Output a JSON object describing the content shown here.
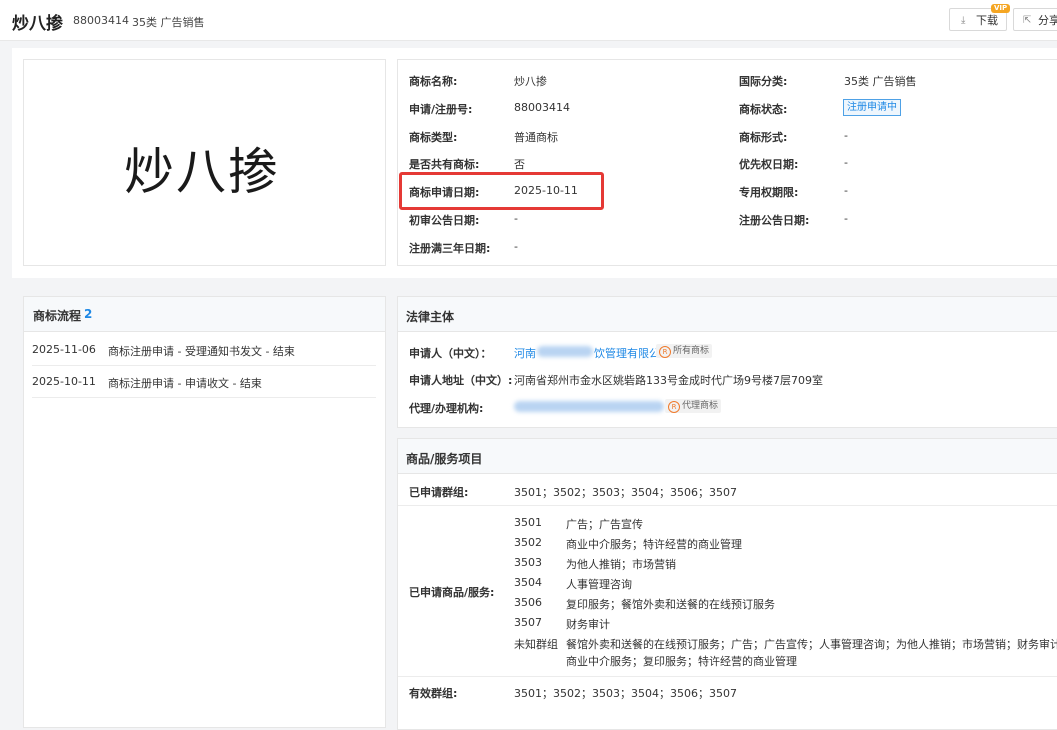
{
  "header": {
    "name": "炒八掺",
    "reg_no": "88003414",
    "class": "35类 广告销售",
    "download_label": "下载",
    "vip_badge": "VIP",
    "share_label": "分享",
    "download_icon": "⤓",
    "share_icon": "⇱"
  },
  "trademark_image_text": "炒八掺",
  "info": {
    "name_label": "商标名称:",
    "name_value": "炒八掺",
    "appno_label": "申请/注册号:",
    "appno_value": "88003414",
    "type_label": "商标类型:",
    "type_value": "普通商标",
    "shared_label": "是否共有商标:",
    "shared_value": "否",
    "appdate_label": "商标申请日期:",
    "appdate_value": "2025-10-11",
    "prelim_label": "初审公告日期:",
    "prelim_value": "-",
    "three_year_label": "注册满三年日期:",
    "three_year_value": "-",
    "intl_class_label": "国际分类:",
    "intl_class_value": "35类 广告销售",
    "status_label": "商标状态:",
    "status_value": "注册申请中",
    "form_label": "商标形式:",
    "form_value": "-",
    "priority_label": "优先权日期:",
    "priority_value": "-",
    "exclusive_label": "专用权期限:",
    "exclusive_value": "-",
    "reg_announce_label": "注册公告日期:",
    "reg_announce_value": "-"
  },
  "flow": {
    "title": "商标流程",
    "count": "2",
    "items": [
      {
        "date": "2025-11-06",
        "desc": "商标注册申请 - 受理通知书发文 - 结束"
      },
      {
        "date": "2025-10-11",
        "desc": "商标注册申请 - 申请收文 - 结束"
      }
    ]
  },
  "legal": {
    "title": "法律主体",
    "applicant_label": "申请人（中文）：",
    "applicant_prefix": "河南",
    "applicant_suffix": "饮管理有限公司",
    "applicant_tag": "所有商标",
    "address_label": "申请人地址（中文）:",
    "address_value": "河南省郑州市金水区姚砦路133号金成时代广场9号楼7层709室",
    "agent_label": "代理/办理机构:",
    "agent_tag": "代理商标",
    "r_icon": "R"
  },
  "goods": {
    "title": "商品/服务项目",
    "groups_label": "已申请群组:",
    "groups_value": "3501；3502；3503；3504；3506；3507",
    "items_label": "已申请商品/服务:",
    "items": [
      {
        "code": "3501",
        "name": "广告；广告宣传"
      },
      {
        "code": "3502",
        "name": "商业中介服务；特许经营的商业管理"
      },
      {
        "code": "3503",
        "name": "为他人推销；市场营销"
      },
      {
        "code": "3504",
        "name": "人事管理咨询"
      },
      {
        "code": "3506",
        "name": "复印服务；餐馆外卖和送餐的在线预订服务"
      },
      {
        "code": "3507",
        "name": "财务审计"
      }
    ],
    "unknown_code": "未知群组",
    "unknown_line1": "餐馆外卖和送餐的在线预订服务；广告；广告宣传；人事管理咨询；为他人推销；市场营销；财务审计；",
    "unknown_line2": "商业中介服务；复印服务；特许经营的商业管理",
    "valid_label": "有效群组:",
    "valid_value": "3501；3502；3503；3504；3506；3507"
  }
}
